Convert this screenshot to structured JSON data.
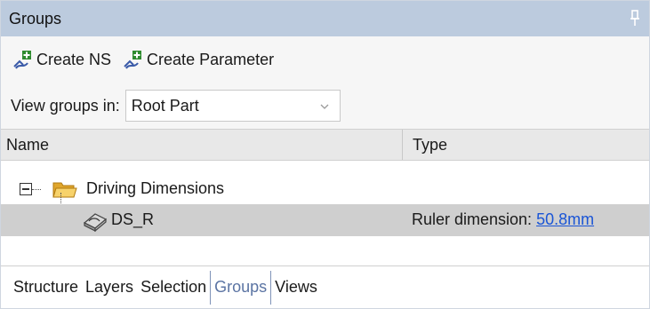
{
  "panel": {
    "title": "Groups"
  },
  "toolbar": {
    "create_ns_label": "Create NS",
    "create_parameter_label": "Create Parameter"
  },
  "view_groups": {
    "label": "View groups in:",
    "selected": "Root Part"
  },
  "columns": {
    "name": "Name",
    "type": "Type"
  },
  "tree": {
    "group_label": "Driving Dimensions",
    "item_name": "DS_R",
    "item_type_prefix": "Ruler dimension: ",
    "item_type_value": "50.8mm"
  },
  "tabs": [
    {
      "label": "Structure",
      "active": false
    },
    {
      "label": "Layers",
      "active": false
    },
    {
      "label": "Selection",
      "active": false
    },
    {
      "label": "Groups",
      "active": true
    },
    {
      "label": "Views",
      "active": false
    }
  ],
  "icons": {
    "pin": "pin-icon",
    "create": "create-group-icon",
    "folder": "folder-icon",
    "dimension": "dimension-icon",
    "dropdown": "chevron-down-icon"
  },
  "colors": {
    "titlebar": "#bccbde",
    "selected_row": "#cfcfcf",
    "link": "#1a55d6",
    "active_tab": "#5b74a3"
  }
}
